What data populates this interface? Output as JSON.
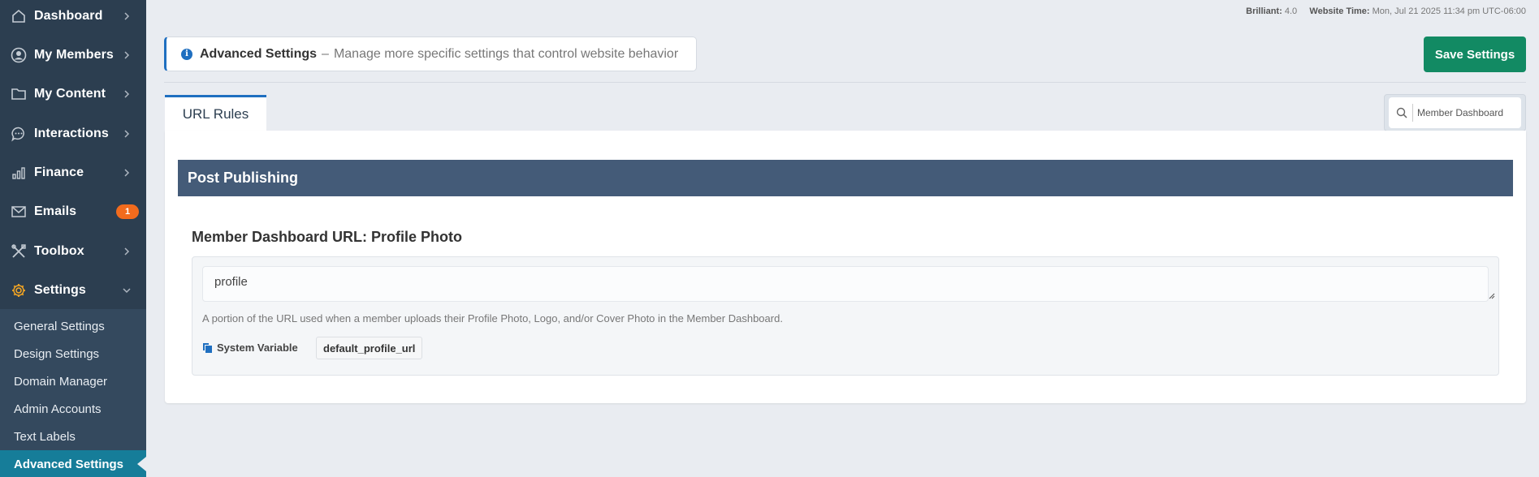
{
  "sidebar": {
    "items": [
      {
        "label": "Dashboard",
        "icon": "home-icon"
      },
      {
        "label": "My Members",
        "icon": "user-circle-icon"
      },
      {
        "label": "My Content",
        "icon": "folder-icon"
      },
      {
        "label": "Interactions",
        "icon": "chat-icon"
      },
      {
        "label": "Finance",
        "icon": "bar-chart-icon"
      },
      {
        "label": "Emails",
        "icon": "mail-icon",
        "badge": "1"
      },
      {
        "label": "Toolbox",
        "icon": "tools-icon"
      },
      {
        "label": "Settings",
        "icon": "gear-icon",
        "expanded": true
      }
    ],
    "settings_submenu": [
      "General Settings",
      "Design Settings",
      "Domain Manager",
      "Admin Accounts",
      "Text Labels",
      "Advanced Settings"
    ],
    "active_submenu": "Advanced Settings",
    "accent_color": "#f5a623"
  },
  "topbar": {
    "version_label": "Brilliant:",
    "version_value": "4.0",
    "time_label": "Website Time:",
    "time_value": "Mon, Jul 21 2025 11:34 pm UTC-06:00"
  },
  "header": {
    "title": "Advanced Settings",
    "separator": "–",
    "description": "Manage more specific settings that control website behavior",
    "save_label": "Save Settings"
  },
  "tabs": [
    {
      "label": "URL Rules",
      "active": true
    }
  ],
  "search": {
    "value": "Member Dashboard"
  },
  "section": {
    "title": "Post Publishing",
    "field_label": "Member Dashboard URL: Profile Photo",
    "field_value": "profile",
    "help_text": "A portion of the URL used when a member uploads their Profile Photo, Logo, and/or Cover Photo in the Member Dashboard.",
    "system_variable_label": "System Variable",
    "system_variable_value": "default_profile_url"
  },
  "colors": {
    "sidebar_bg": "#2c3e50",
    "submenu_active": "#167d99",
    "primary_blue": "#1f6fc0",
    "save_green": "#128a63",
    "section_header": "#445b78",
    "badge_orange": "#f26b1d"
  }
}
